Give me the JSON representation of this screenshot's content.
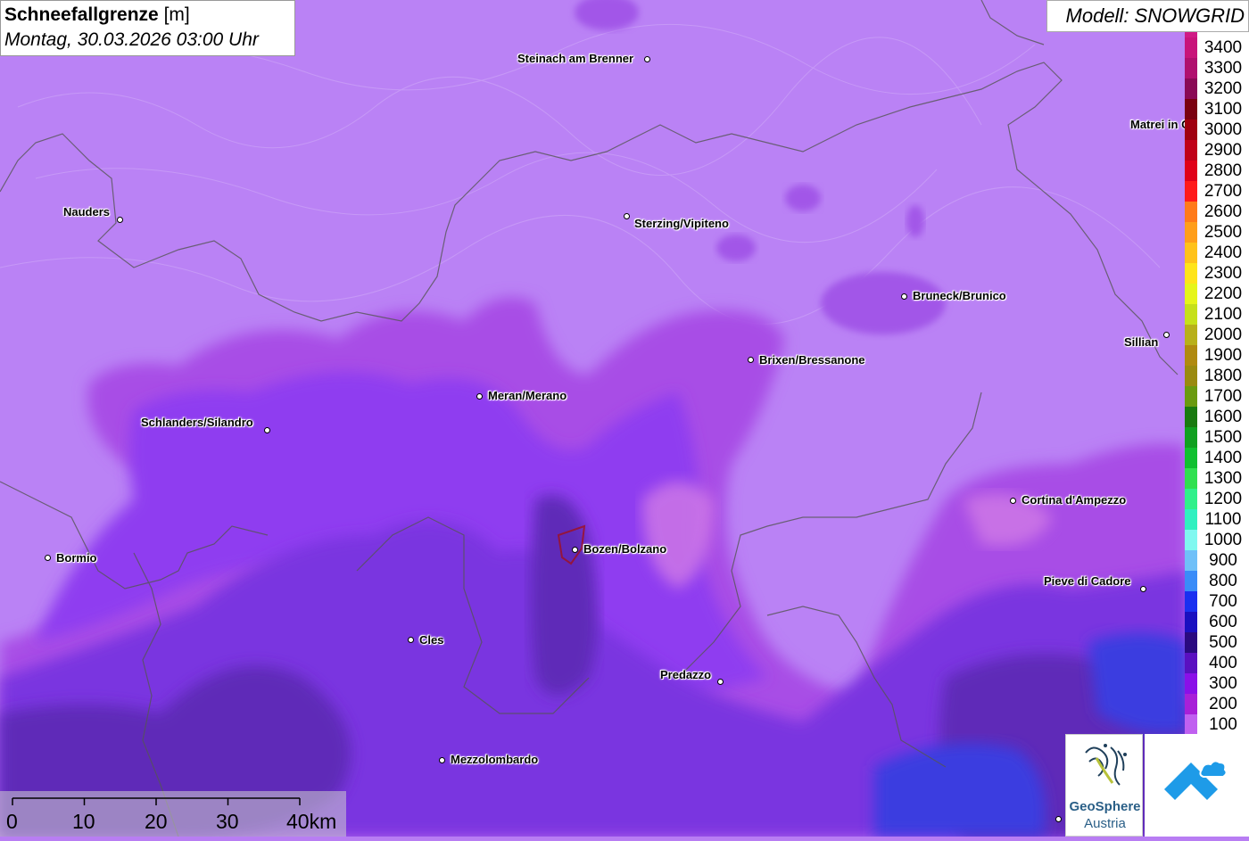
{
  "title": {
    "main": "Schneefallgrenze",
    "unit": "[m]",
    "datetime": "Montag, 30.03.2026 03:00 Uhr"
  },
  "model_label": "Modell: SNOWGRID",
  "legend": {
    "levels": [
      {
        "label": "3500",
        "color": "#d01a85"
      },
      {
        "label": "3400",
        "color": "#c8147a"
      },
      {
        "label": "3300",
        "color": "#b0106e"
      },
      {
        "label": "3200",
        "color": "#8a0a55"
      },
      {
        "label": "3100",
        "color": "#7a0010"
      },
      {
        "label": "3000",
        "color": "#a00010"
      },
      {
        "label": "2900",
        "color": "#c00018"
      },
      {
        "label": "2800",
        "color": "#e00018"
      },
      {
        "label": "2700",
        "color": "#ff1a1a"
      },
      {
        "label": "2600",
        "color": "#ff7a1a"
      },
      {
        "label": "2500",
        "color": "#ff9e1a"
      },
      {
        "label": "2400",
        "color": "#ffc21a"
      },
      {
        "label": "2300",
        "color": "#ffe41a"
      },
      {
        "label": "2200",
        "color": "#e6f51a"
      },
      {
        "label": "2100",
        "color": "#c6e01a"
      },
      {
        "label": "2000",
        "color": "#b8b01a"
      },
      {
        "label": "1900",
        "color": "#b08a10"
      },
      {
        "label": "1800",
        "color": "#9a8a10"
      },
      {
        "label": "1700",
        "color": "#6a9a10"
      },
      {
        "label": "1600",
        "color": "#1a7a10"
      },
      {
        "label": "1500",
        "color": "#10a020"
      },
      {
        "label": "1400",
        "color": "#10c030"
      },
      {
        "label": "1300",
        "color": "#30e050"
      },
      {
        "label": "1200",
        "color": "#30f08a"
      },
      {
        "label": "1100",
        "color": "#30f0c0"
      },
      {
        "label": "1000",
        "color": "#80f8f0"
      },
      {
        "label": "900",
        "color": "#70c0f8"
      },
      {
        "label": "800",
        "color": "#3a8cf8"
      },
      {
        "label": "700",
        "color": "#1a30f0"
      },
      {
        "label": "600",
        "color": "#1a10c0"
      },
      {
        "label": "500",
        "color": "#2a0a80"
      },
      {
        "label": "400",
        "color": "#5a10c0"
      },
      {
        "label": "300",
        "color": "#8a10e8"
      },
      {
        "label": "200",
        "color": "#a820d8"
      },
      {
        "label": "100",
        "color": "#c060f0"
      }
    ]
  },
  "places": [
    {
      "name": "Steinach am Brenner"
    },
    {
      "name": "Nauders"
    },
    {
      "name": "Sterzing/Vipiteno"
    },
    {
      "name": "Matrei in Osttirol"
    },
    {
      "name": "Bruneck/Brunico"
    },
    {
      "name": "Sillian"
    },
    {
      "name": "Brixen/Bressanone"
    },
    {
      "name": "Meran/Merano"
    },
    {
      "name": "Schlanders/Silandro"
    },
    {
      "name": "Cortina d'Ampezzo"
    },
    {
      "name": "Bozen/Bolzano"
    },
    {
      "name": "Bormio"
    },
    {
      "name": "Pieve di Cadore"
    },
    {
      "name": "Cles"
    },
    {
      "name": "Predazzo"
    },
    {
      "name": "Mezzolombardo"
    }
  ],
  "scale_bar": {
    "ticks": [
      "0",
      "10",
      "20",
      "30",
      "40km"
    ]
  },
  "logos": {
    "geosphere_line1": "GeoSphere",
    "geosphere_line2": "Austria"
  }
}
